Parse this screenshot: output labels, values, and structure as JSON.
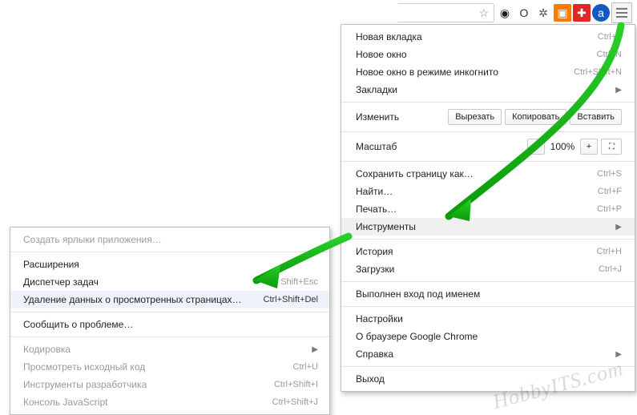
{
  "toolbar": {
    "star": "☆",
    "icons": [
      {
        "name": "ext-eye-icon",
        "glyph": "◉",
        "bg": "#fff",
        "fg": "#1a1a1a"
      },
      {
        "name": "ext-opera-icon",
        "glyph": "O",
        "bg": "#fff",
        "fg": "#333"
      },
      {
        "name": "ext-bug-icon",
        "glyph": "✲",
        "bg": "#fff",
        "fg": "#555"
      },
      {
        "name": "ext-rss-icon",
        "glyph": "▣",
        "bg": "#ff7a00",
        "fg": "#fff"
      },
      {
        "name": "ext-plus-icon",
        "glyph": "✚",
        "bg": "#e02626",
        "fg": "#fff"
      },
      {
        "name": "ext-a-icon",
        "glyph": "a",
        "bg": "#1159c3",
        "fg": "#fff"
      }
    ]
  },
  "menu": {
    "new_tab": "Новая вкладка",
    "new_tab_k": "Ctrl+T",
    "new_window": "Новое окно",
    "new_window_k": "Ctrl+N",
    "incognito": "Новое окно в режиме инкогнито",
    "incognito_k": "Ctrl+Shift+N",
    "bookmarks": "Закладки",
    "edit_label": "Изменить",
    "cut": "Вырезать",
    "copy": "Копировать",
    "paste": "Вставить",
    "zoom_label": "Масштаб",
    "zoom_minus": "–",
    "zoom_value": "100%",
    "zoom_plus": "+",
    "save": "Сохранить страницу как…",
    "save_k": "Ctrl+S",
    "find": "Найти…",
    "find_k": "Ctrl+F",
    "print": "Печать…",
    "print_k": "Ctrl+P",
    "tools": "Инструменты",
    "history": "История",
    "history_k": "Ctrl+H",
    "downloads": "Загрузки",
    "downloads_k": "Ctrl+J",
    "signed_in": "Выполнен вход под именем",
    "settings": "Настройки",
    "about": "О браузере Google Chrome",
    "help": "Справка",
    "exit": "Выход"
  },
  "submenu": {
    "shortcuts": "Создать ярлыки приложения…",
    "extensions": "Расширения",
    "task_mgr": "Диспетчер задач",
    "task_mgr_k": "Shift+Esc",
    "clear_data": "Удаление данных о просмотренных страницах…",
    "clear_data_k": "Ctrl+Shift+Del",
    "report": "Сообщить о проблеме…",
    "encoding": "Кодировка",
    "view_source": "Просмотреть исходный код",
    "view_source_k": "Ctrl+U",
    "dev_tools": "Инструменты разработчика",
    "dev_tools_k": "Ctrl+Shift+I",
    "js_console": "Консоль JavaScript",
    "js_console_k": "Ctrl+Shift+J"
  },
  "watermark": "HobbyITS.com"
}
